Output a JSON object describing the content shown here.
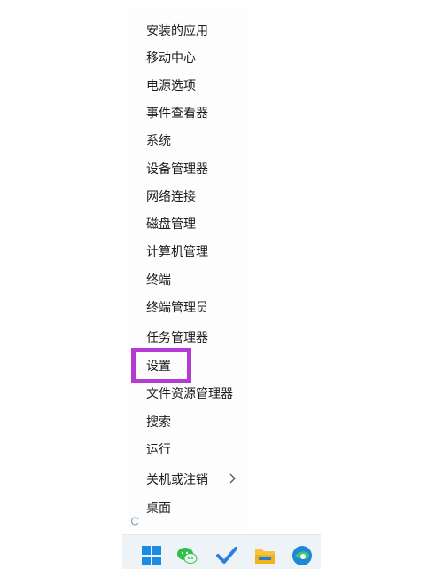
{
  "context_menu": {
    "items": [
      {
        "label": "安装的应用"
      },
      {
        "label": "移动中心"
      },
      {
        "label": "电源选项"
      },
      {
        "label": "事件查看器"
      },
      {
        "label": "系统"
      },
      {
        "label": "设备管理器"
      },
      {
        "label": "网络连接"
      },
      {
        "label": "磁盘管理"
      },
      {
        "label": "计算机管理"
      },
      {
        "label": "终端"
      },
      {
        "label": "终端管理员"
      },
      {
        "label": "任务管理器"
      },
      {
        "label": "设置",
        "highlighted": true
      },
      {
        "label": "文件资源管理器"
      },
      {
        "label": "搜索"
      },
      {
        "label": "运行"
      },
      {
        "label": "关机或注销",
        "has_submenu": true
      },
      {
        "label": "桌面"
      }
    ],
    "submenu_icon": "chevron-right-icon"
  },
  "annotation": {
    "highlight_color": "#b43ad3"
  },
  "taskbar": {
    "icons": [
      "windows-start-icon",
      "wechat-icon",
      "todo-check-icon",
      "file-explorer-icon",
      "edge-browser-icon"
    ]
  }
}
